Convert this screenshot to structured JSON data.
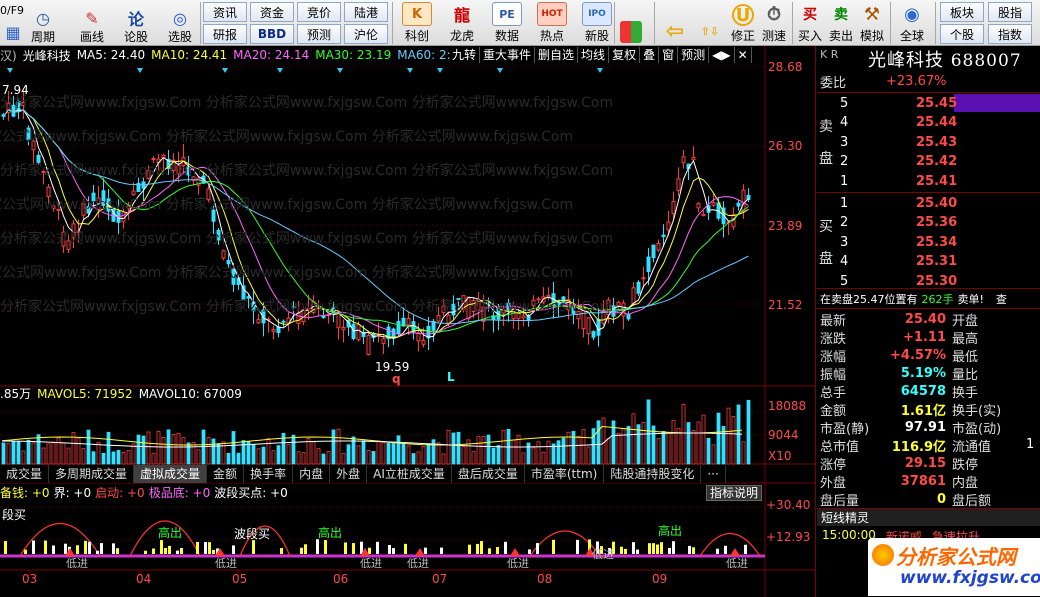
{
  "toolbar": {
    "items": [
      {
        "label": "",
        "icon": "calendar-icon"
      },
      {
        "label": "周期",
        "icon": "clock-icon"
      },
      {
        "label": "画线",
        "icon": "pen-icon"
      },
      {
        "label": "论股",
        "icon": "discuss-icon",
        "glyph": "论"
      },
      {
        "label": "选股",
        "icon": "select-icon"
      }
    ],
    "small_buttons": [
      {
        "label": "资讯",
        "bold": false
      },
      {
        "label": "研报",
        "bold": false
      },
      {
        "label": "资金",
        "bold": false
      },
      {
        "label": "BBD",
        "bold": true
      },
      {
        "label": "竞价",
        "bold": false
      },
      {
        "label": "预测",
        "bold": false
      },
      {
        "label": "陆港",
        "bold": false
      },
      {
        "label": "沪伦",
        "bold": false
      }
    ],
    "big_buttons": [
      {
        "label": "科创",
        "glyph": "K",
        "color": "#cc6600"
      },
      {
        "label": "龙虎",
        "glyph": "龍",
        "color": "#cc0000"
      },
      {
        "label": "数据",
        "glyph": "PE",
        "color": "#2a5aa8"
      },
      {
        "label": "热点",
        "glyph": "HOT",
        "color": "#cc2200"
      },
      {
        "label": "新股",
        "glyph": "IPO",
        "color": "#2a6ab0"
      }
    ],
    "right_items": [
      {
        "label": "",
        "glyph": "▦"
      },
      {
        "label": "",
        "glyph": "⇦"
      },
      {
        "label": "",
        "glyph": "⇧⇩"
      },
      {
        "label": "修正",
        "glyph": "U"
      },
      {
        "label": "测速",
        "glyph": "⏱"
      },
      {
        "label": "买入",
        "glyph": "买"
      },
      {
        "label": "卖出",
        "glyph": "卖"
      },
      {
        "label": "模拟",
        "glyph": "⚒"
      },
      {
        "label": "全球",
        "glyph": "◉"
      }
    ],
    "extra_buttons": [
      {
        "label": "板块"
      },
      {
        "label": "个股"
      },
      {
        "label": "股指"
      },
      {
        "label": "指数"
      }
    ]
  },
  "chart_header": {
    "prefix": "汉)",
    "stock": "光峰科技",
    "ma5": "MA5: 24.40",
    "ma10": "MA10: 24.41",
    "ma20": "MA20: 24.14",
    "ma30": "MA30: 23.19",
    "ma60": "MA60: 2:"
  },
  "menubar": [
    "九转",
    "重大事件",
    "删自选",
    "均线",
    "复权",
    "叠",
    "窗",
    "预测"
  ],
  "price_axis": [
    "28.68",
    "26.30",
    "23.89",
    "21.52"
  ],
  "price_labels": {
    "high": "7.94",
    "low": "19.59"
  },
  "volume_header": {
    "first": ".85万",
    "mavol5": "MAVOL5: 71952",
    "mavol10": "MAVOL10: 67009"
  },
  "volume_axis": [
    "18088",
    "9044",
    "X10"
  ],
  "tabs": [
    "成交量",
    "多周期成交量",
    "虚拟成交量",
    "金额",
    "换手率",
    "内盘",
    "外盘",
    "AI立桩成交量",
    "盘后成交量",
    "市盈率(ttm)",
    "陆股通持股变化",
    "···"
  ],
  "active_tab": 2,
  "indicator_header": {
    "a": "备钱: +0",
    "b": "界: +0",
    "c": "启动: +0",
    "d": "极品底: +0",
    "e": "波段买点: +0",
    "help": "指标说明"
  },
  "indicator_axis": [
    "+30.40",
    "+12.93"
  ],
  "signals": {
    "buy": "段买",
    "sell": "高出",
    "enter": "低进",
    "buy2": "波段买"
  },
  "months": [
    "03",
    "04",
    "05",
    "06",
    "07",
    "08",
    "09"
  ],
  "date_label": "0/F9",
  "quote": {
    "title": "光峰科技",
    "code": "688007",
    "kr": "K R",
    "wb_label": "委比",
    "wb_value": "+23.67%",
    "sell_label": "卖",
    "sell_label2": "盘",
    "buy_label": "买",
    "buy_label2": "盘",
    "asks": [
      {
        "lvl": "5",
        "price": "25.45"
      },
      {
        "lvl": "4",
        "price": "25.44"
      },
      {
        "lvl": "3",
        "price": "25.43"
      },
      {
        "lvl": "2",
        "price": "25.42"
      },
      {
        "lvl": "1",
        "price": "25.41"
      }
    ],
    "bids": [
      {
        "lvl": "1",
        "price": "25.40"
      },
      {
        "lvl": "2",
        "price": "25.36"
      },
      {
        "lvl": "3",
        "price": "25.34"
      },
      {
        "lvl": "4",
        "price": "25.31"
      },
      {
        "lvl": "5",
        "price": "25.30"
      }
    ],
    "notice_a": "在卖盘25.47位置有",
    "notice_b": "262手",
    "notice_c": "卖单!",
    "notice_d": "查",
    "stats": [
      {
        "l": "最新",
        "v": "25.40",
        "c": "red",
        "r": "开盘"
      },
      {
        "l": "涨跌",
        "v": "+1.11",
        "c": "red",
        "r": "最高"
      },
      {
        "l": "涨幅",
        "v": "+4.57%",
        "c": "red",
        "r": "最低"
      },
      {
        "l": "振幅",
        "v": "5.19%",
        "c": "cyan",
        "r": "量比"
      },
      {
        "l": "总手",
        "v": "64578",
        "c": "cyan",
        "r": "换手"
      },
      {
        "l": "金额",
        "v": "1.61亿",
        "c": "yel",
        "r": "换手(实)"
      },
      {
        "l": "市盈(静)",
        "v": "97.91",
        "c": "wht",
        "r": "市盈(动)"
      },
      {
        "l": "总市值",
        "v": "116.9亿",
        "c": "yel",
        "r": "流通值"
      },
      {
        "l": "涨停",
        "v": "29.15",
        "c": "red",
        "r": "跌停"
      },
      {
        "l": "外盘",
        "v": "37861",
        "c": "red",
        "r": "内盘"
      },
      {
        "l": "盘后量",
        "v": "0",
        "c": "yel",
        "r": "盘后额"
      }
    ],
    "liutong_tail": "1",
    "sprite_title": "短线精灵",
    "sprite_row_time": "15:00:00",
    "sprite_row_a": "新诺威",
    "sprite_row_b": "急速拉升"
  },
  "watermark": "分析家公式网www.fxjgsw.Com",
  "brand": {
    "name": "分析家公式网",
    "url": "www.fxjgsw.com"
  },
  "colors": {
    "up": "#ff3c3c",
    "down": "#33e0ff",
    "ma5": "#ffffff",
    "ma10": "#ffff33",
    "ma20": "#ff66ff",
    "ma30": "#33ff33",
    "ma60": "#66ccff"
  }
}
